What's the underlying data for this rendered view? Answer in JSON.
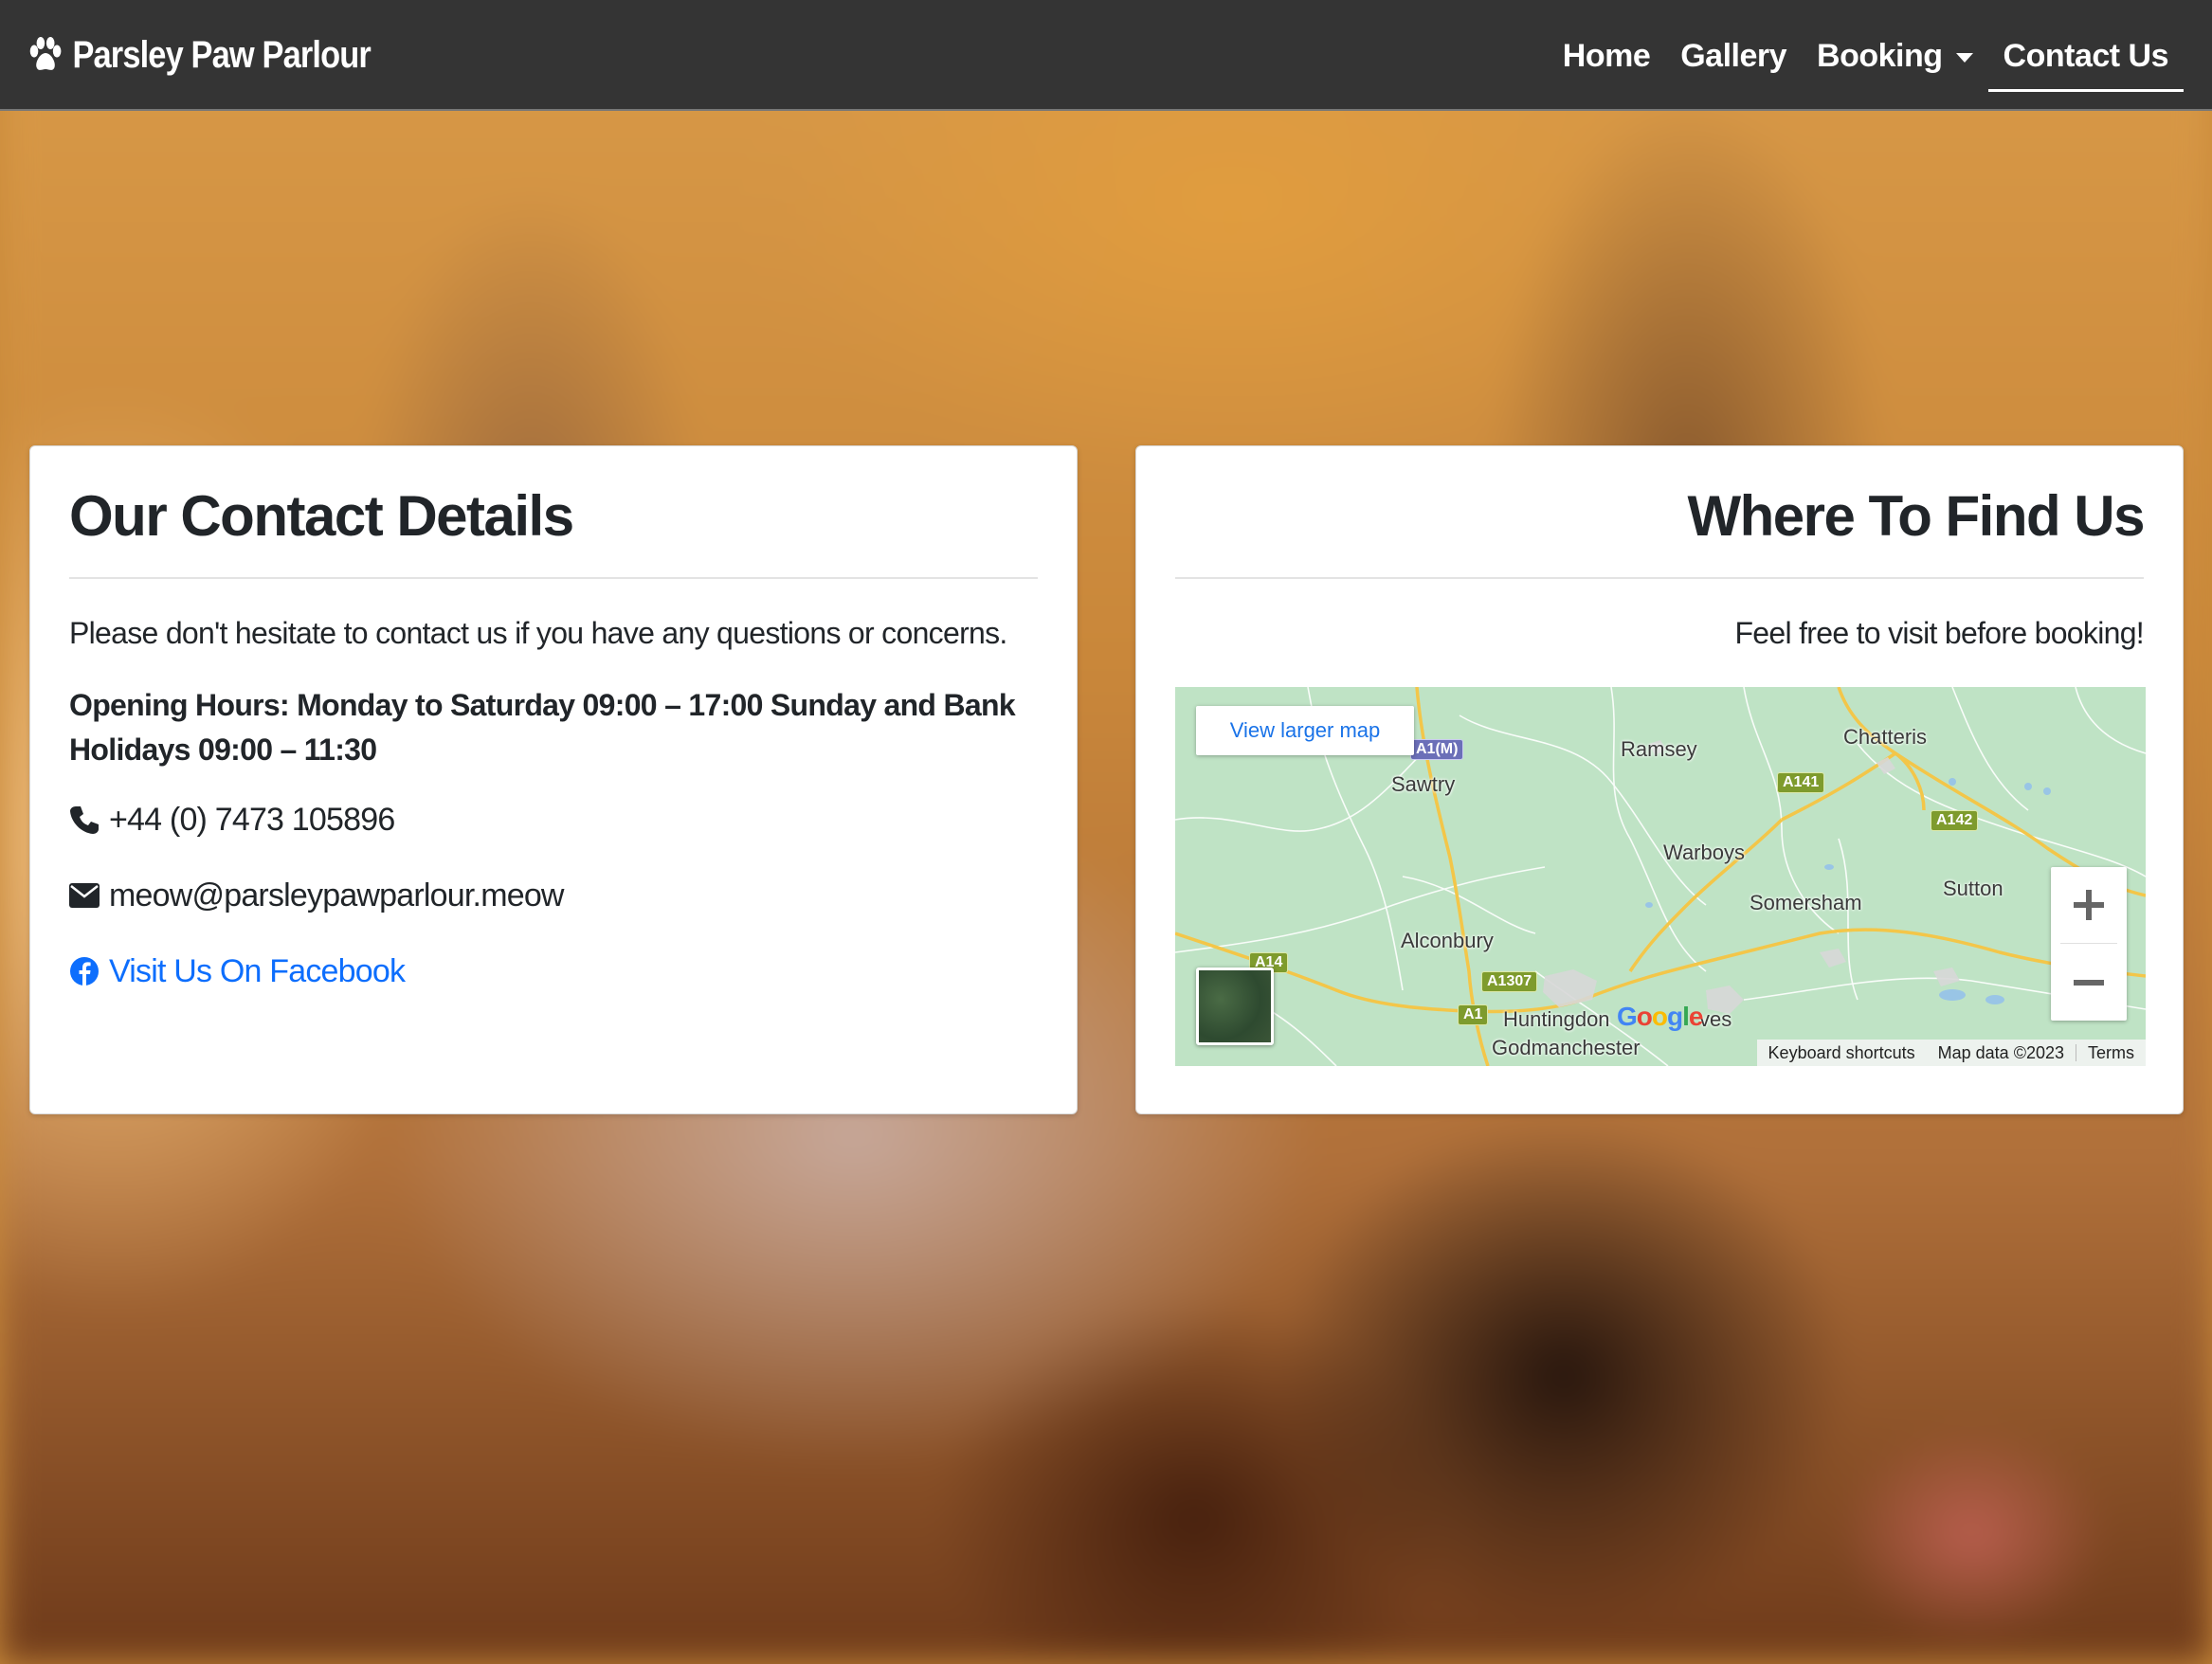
{
  "navbar": {
    "brand": "Parsley Paw Parlour",
    "brand_icon": "paw-icon",
    "items": [
      {
        "label": "Home"
      },
      {
        "label": "Gallery"
      },
      {
        "label": "Booking",
        "has_dropdown": true
      },
      {
        "label": "Contact Us",
        "active": true
      }
    ]
  },
  "contact": {
    "title": "Our Contact Details",
    "intro": "Please don't hesitate to contact us if you have any questions or concerns.",
    "hours": "Opening Hours: Monday to Saturday 09:00 – 17:00 Sunday and Bank Holidays 09:00 – 11:30",
    "phone": "+44 (0) 7473 105896",
    "email": "meow@parsleypawparlour.meow",
    "facebook": "Visit Us On Facebook",
    "icons": [
      "phone-icon",
      "envelope-icon",
      "facebook-icon"
    ]
  },
  "find_us": {
    "title": "Where To Find Us",
    "subtitle": "Feel free to visit before booking!"
  },
  "map": {
    "view_larger": "View larger map",
    "places": [
      "Ramsey",
      "Chatteris",
      "Sawtry",
      "Warboys",
      "Somersham",
      "Sutton",
      "Alconbury",
      "Huntingdon",
      "Godmanchester",
      "ves"
    ],
    "roads": [
      "A1(M)",
      "A141",
      "A142",
      "A14",
      "A1307",
      "A1"
    ],
    "logo": "Google",
    "attribution": {
      "shortcuts": "Keyboard shortcuts",
      "data": "Map data ©2023",
      "terms": "Terms"
    }
  },
  "colors": {
    "navbar_bg": "#343434",
    "link": "#0d6efd",
    "map_bg": "#bfe3c5",
    "road": "#f3c649"
  }
}
